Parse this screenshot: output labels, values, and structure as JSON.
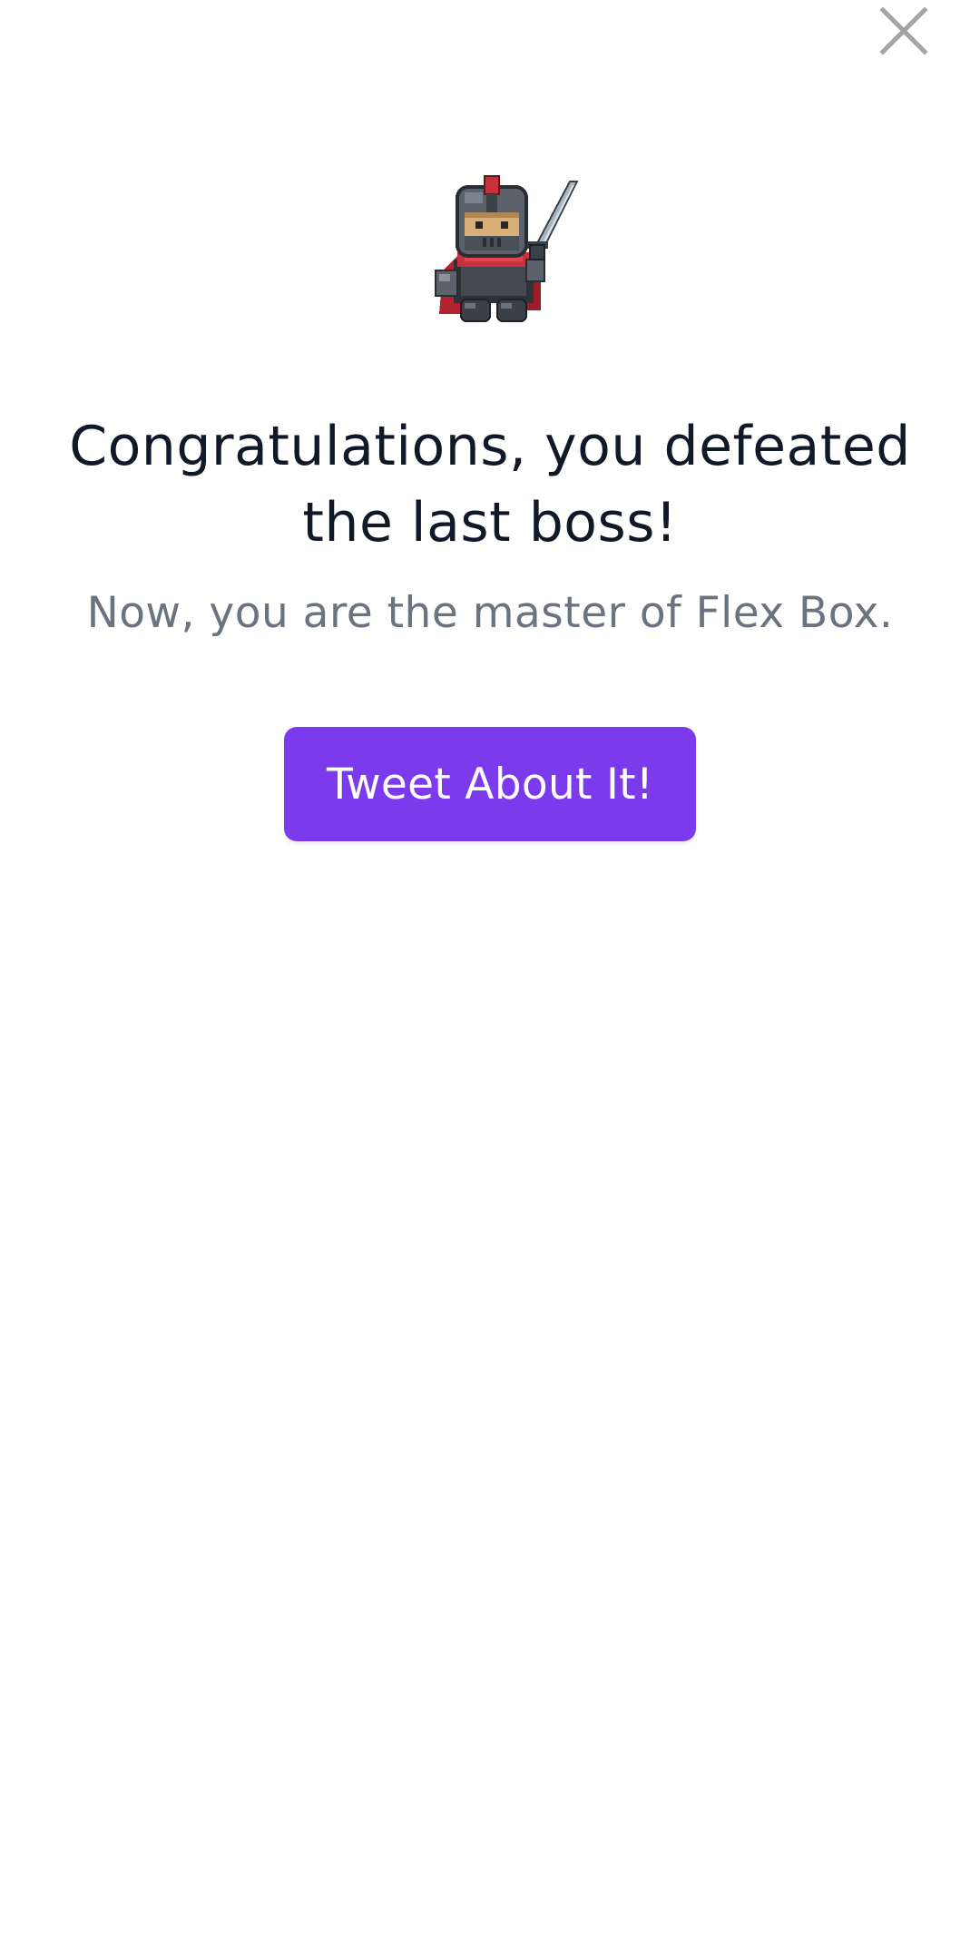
{
  "close_button": {
    "icon": "close-icon",
    "color": "#a3a3a3"
  },
  "hero": {
    "icon": "pixel-knight-icon"
  },
  "title": "Congratulations, you defeated the last boss!",
  "subtitle": "Now, you are the master of Flex Box.",
  "tweet_button": {
    "label": "Tweet About It!",
    "color": "#7c3aed"
  },
  "colors": {
    "title": "#111827",
    "subtitle": "#6b7280",
    "background": "#ffffff"
  }
}
